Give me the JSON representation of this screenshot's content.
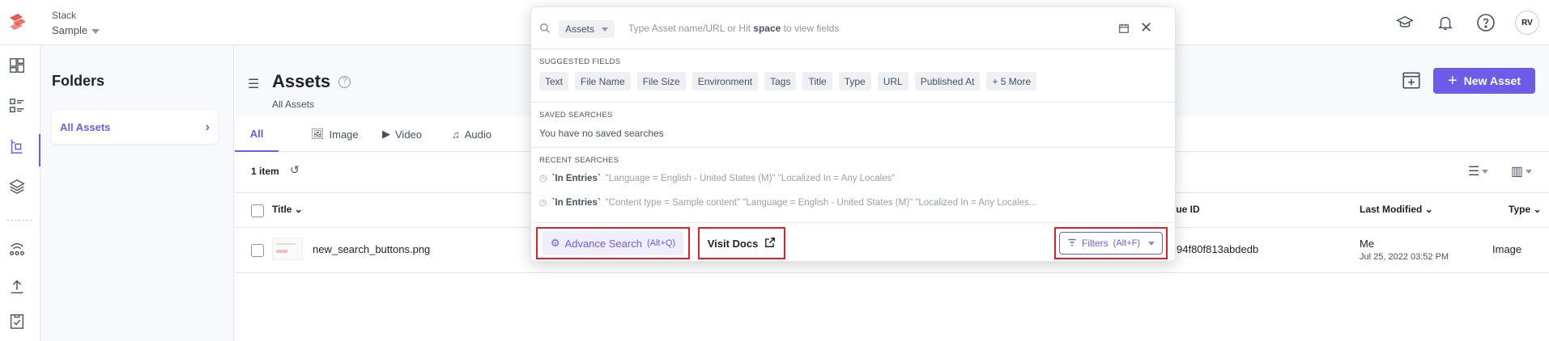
{
  "header": {
    "stack_label": "Stack",
    "stack_name": "Sample",
    "avatar_initials": "RV",
    "icons": [
      "academy-cap-icon",
      "bell-icon",
      "help-icon"
    ]
  },
  "rail": {
    "icons": [
      "dashboard-icon",
      "entries-icon",
      "assets-icon",
      "content-models-icon",
      "releases-icon",
      "deploy-icon",
      "tasks-icon"
    ]
  },
  "folders": {
    "title": "Folders",
    "items": [
      {
        "label": "All Assets"
      }
    ]
  },
  "main": {
    "title": "Assets",
    "subtitle": "All Assets",
    "new_asset_label": "New Asset",
    "tabs": [
      {
        "label": "All",
        "active": true
      },
      {
        "label": "Image",
        "icon": "image-icon"
      },
      {
        "label": "Video",
        "icon": "video-icon"
      },
      {
        "label": "Audio",
        "icon": "audio-icon"
      }
    ],
    "item_count": "1 item",
    "columns": {
      "title": "Title",
      "unique_id": "que ID",
      "last_modified": "Last Modified",
      "type": "Type"
    },
    "rows": [
      {
        "filename": "new_search_buttons.png",
        "unique_id": "94f80f813abdedb",
        "modified_by": "Me",
        "modified_date": "Jul 25, 2022 03:52 PM",
        "type": "Image"
      }
    ]
  },
  "search": {
    "scope": "Assets",
    "placeholder_before": "Type Asset name/URL or Hit ",
    "placeholder_key": "space",
    "placeholder_after": " to view fields",
    "suggested_title": "SUGGESTED FIELDS",
    "suggested_fields": [
      "Text",
      "File Name",
      "File Size",
      "Environment",
      "Tags",
      "Title",
      "Type",
      "URL",
      "Published At",
      "+ 5 More"
    ],
    "saved_title": "SAVED SEARCHES",
    "saved_empty": "You have no saved searches",
    "recent_title": "RECENT SEARCHES",
    "recent": [
      {
        "scope": "`In Entries`",
        "query": "\"Language = English - United States (M)\" \"Localized In = Any Locales\""
      },
      {
        "scope": "`In Entries`",
        "query": "\"Content type = Sample content\" \"Language = English - United States (M)\" \"Localized In = Any Locales..."
      }
    ],
    "advance_label": "Advance Search",
    "advance_shortcut": "(Alt+Q)",
    "docs_label": "Visit Docs",
    "filters_label": "Filters",
    "filters_shortcut": "(Alt+F)"
  },
  "colors": {
    "accent": "#6c5ce7",
    "highlight_border": "#e0202a",
    "logo": "#e8584f"
  }
}
